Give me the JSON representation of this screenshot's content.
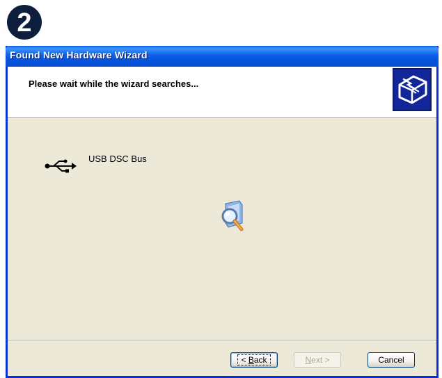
{
  "step_number": "2",
  "window": {
    "title": "Found New Hardware Wizard",
    "header_text": "Please wait while the wizard searches..."
  },
  "device": {
    "name": "USB DSC Bus",
    "icon": "usb-icon"
  },
  "buttons": {
    "back": {
      "prefix": "< ",
      "mnemonic": "B",
      "rest": "ack"
    },
    "next": {
      "mnemonic": "N",
      "rest": "ext >"
    },
    "cancel": "Cancel"
  },
  "colors": {
    "titlebar": "#0a5fd8",
    "window_frame": "#0831d9",
    "dialog_bg": "#ece9d8"
  }
}
